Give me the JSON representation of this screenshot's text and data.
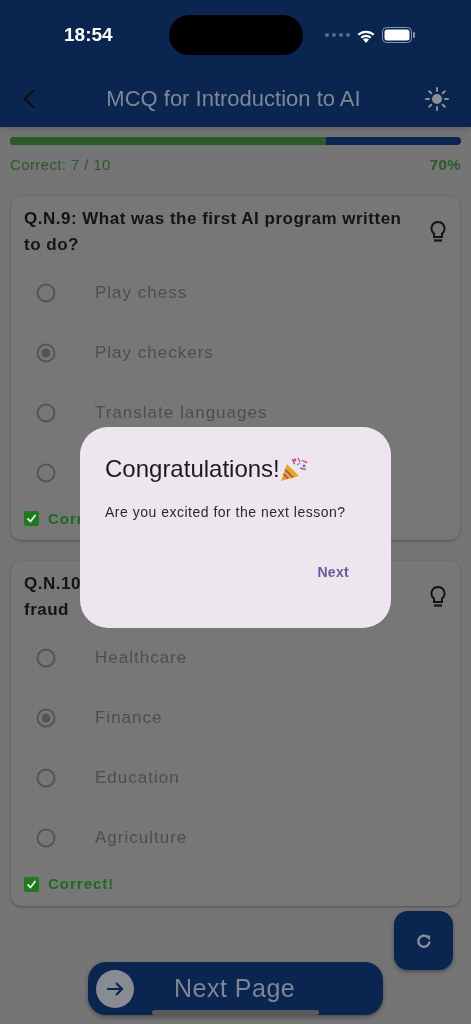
{
  "status_bar": {
    "time": "18:54"
  },
  "app_bar": {
    "title": "MCQ for Introduction to AI"
  },
  "progress": {
    "level": 0.7,
    "correct_label": "Correct: 7 / 10",
    "percent": "70%"
  },
  "questions": [
    {
      "question_lines": [
        "Q.N.9: What was the first AI program written",
        "to do?"
      ],
      "options": [
        {
          "label": "Play chess",
          "selected": false
        },
        {
          "label": "Play checkers",
          "selected": true
        },
        {
          "label": "Translate languages",
          "selected": false
        },
        {
          "selected": false
        }
      ],
      "result": {
        "label": "Corr",
        "correct": true
      }
    },
    {
      "question_lines": [
        "Q.N.10",
        "fraud"
      ],
      "options": [
        {
          "label": "Healthcare",
          "selected": false
        },
        {
          "label": "Finance",
          "selected": true
        },
        {
          "label": "Education",
          "selected": false
        },
        {
          "label": "Agriculture",
          "selected": false
        }
      ],
      "result": {
        "label": "Correct!",
        "correct": true
      }
    }
  ],
  "next_page_button": {
    "label": "Next Page"
  },
  "dialog": {
    "title": "Congratulations!",
    "message": "Are you excited for the next lesson?",
    "action": "Next"
  }
}
